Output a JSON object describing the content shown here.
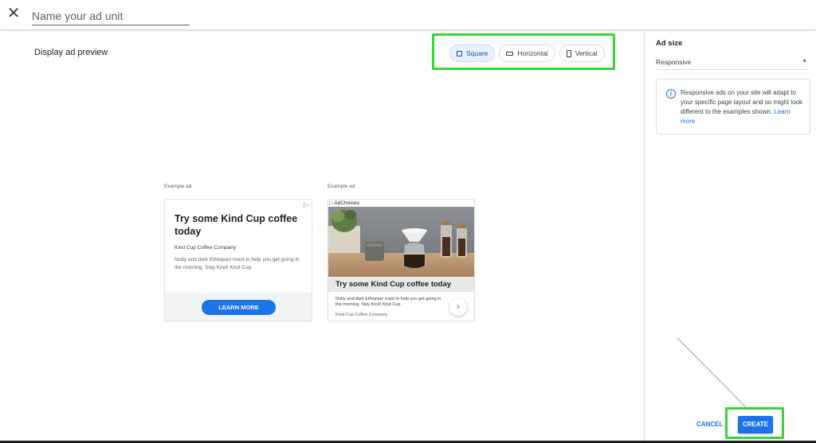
{
  "topbar": {
    "close_icon": "close-icon",
    "close_glyph": "✕",
    "name_placeholder": "Name your ad unit"
  },
  "preview": {
    "title": "Display ad preview",
    "toggles": [
      {
        "label": "Square",
        "icon": "square-icon",
        "active": true
      },
      {
        "label": "Horizontal",
        "icon": "horizontal-rect-icon",
        "active": false
      },
      {
        "label": "Vertical",
        "icon": "vertical-rect-icon",
        "active": false
      }
    ]
  },
  "ads": [
    {
      "label": "Example ad",
      "adchoice_glyph": "▷",
      "headline": "Try some Kind Cup coffee today",
      "company": "Kind Cup Coffee Company",
      "description": "Nutty and dark Ethiopian roast to help you get going in the morning. Stay Kind! Kind Cup.",
      "cta": "LEARN MORE"
    },
    {
      "label": "Example ad",
      "adchoices_text": "AdChoices",
      "adchoice_glyph": "▷",
      "headline": "Try some Kind Cup coffee today",
      "description": "Nutty and dark Ethiopian roast to help you get going in the morning. Stay Kind! Kind Cup.",
      "company": "Kind Cup Coffee Company",
      "arrow_glyph": "›"
    }
  ],
  "sidebar": {
    "title": "Ad size",
    "select_value": "Responsive",
    "caret_glyph": "▼",
    "info_icon_glyph": "i",
    "info_text": "Responsive ads on your site will adapt to your specific page layout and so might look different to the examples shown.",
    "info_link": "Learn more"
  },
  "actions": {
    "cancel": "CANCEL",
    "create": "CREATE"
  },
  "colors": {
    "accent": "#1a73e8",
    "highlight": "#39d436",
    "active_toggle_bg": "#e8f0fe"
  }
}
